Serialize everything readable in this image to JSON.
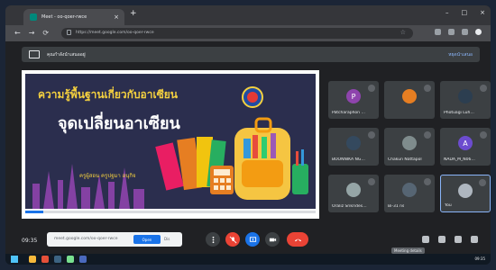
{
  "browser": {
    "tab_title": "Meet - oo-qoer-rwce",
    "tab_close": "×",
    "new_tab": "+",
    "url": "https://meet.google.com/oo-qoer-rwce",
    "window_controls": [
      "–",
      "□",
      "×"
    ]
  },
  "meet": {
    "presenting_label": "คุณกำลังนำเสนออยู่",
    "stop_presenting": "หยุดนำเสนอ",
    "time": "09:35",
    "meeting_code": "meet.google.com/oo-qoer-rwce",
    "open_button": "Open",
    "dismiss_button": "Dis",
    "tooltip": "Meeting details"
  },
  "slide": {
    "title_line1": "ความรู้พื้นฐานเกี่ยวกับอาเซียน",
    "title_line2": "จุดเปลี่ยนอาเซียน",
    "author": "ครูผู้สอน ครูปฐมา อนุกิจ"
  },
  "participants": [
    {
      "name": "Patcharaphon …",
      "initial": "P",
      "color": "#8e44ad"
    },
    {
      "name": "",
      "initial": "",
      "color": "#e67e22"
    },
    {
      "name": "Photuagi Luh…",
      "initial": "",
      "color": "#2c3e50"
    },
    {
      "name": "BOONNIKA NG…",
      "initial": "",
      "color": "#34495e"
    },
    {
      "name": "Chakun Nattapol",
      "initial": "",
      "color": "#7f8c8d"
    },
    {
      "name": "NADA_M_N06…",
      "initial": "A",
      "color": "#6c4ccf"
    },
    {
      "name": "Oraliz Srikrides…",
      "initial": "",
      "color": "#95a5a6"
    },
    {
      "name": "Bi-31 ns",
      "initial": "",
      "color": "#566573"
    },
    {
      "name": "You",
      "initial": "",
      "color": "#aeb6bf"
    }
  ],
  "taskbar": {
    "clock": "09:35"
  }
}
